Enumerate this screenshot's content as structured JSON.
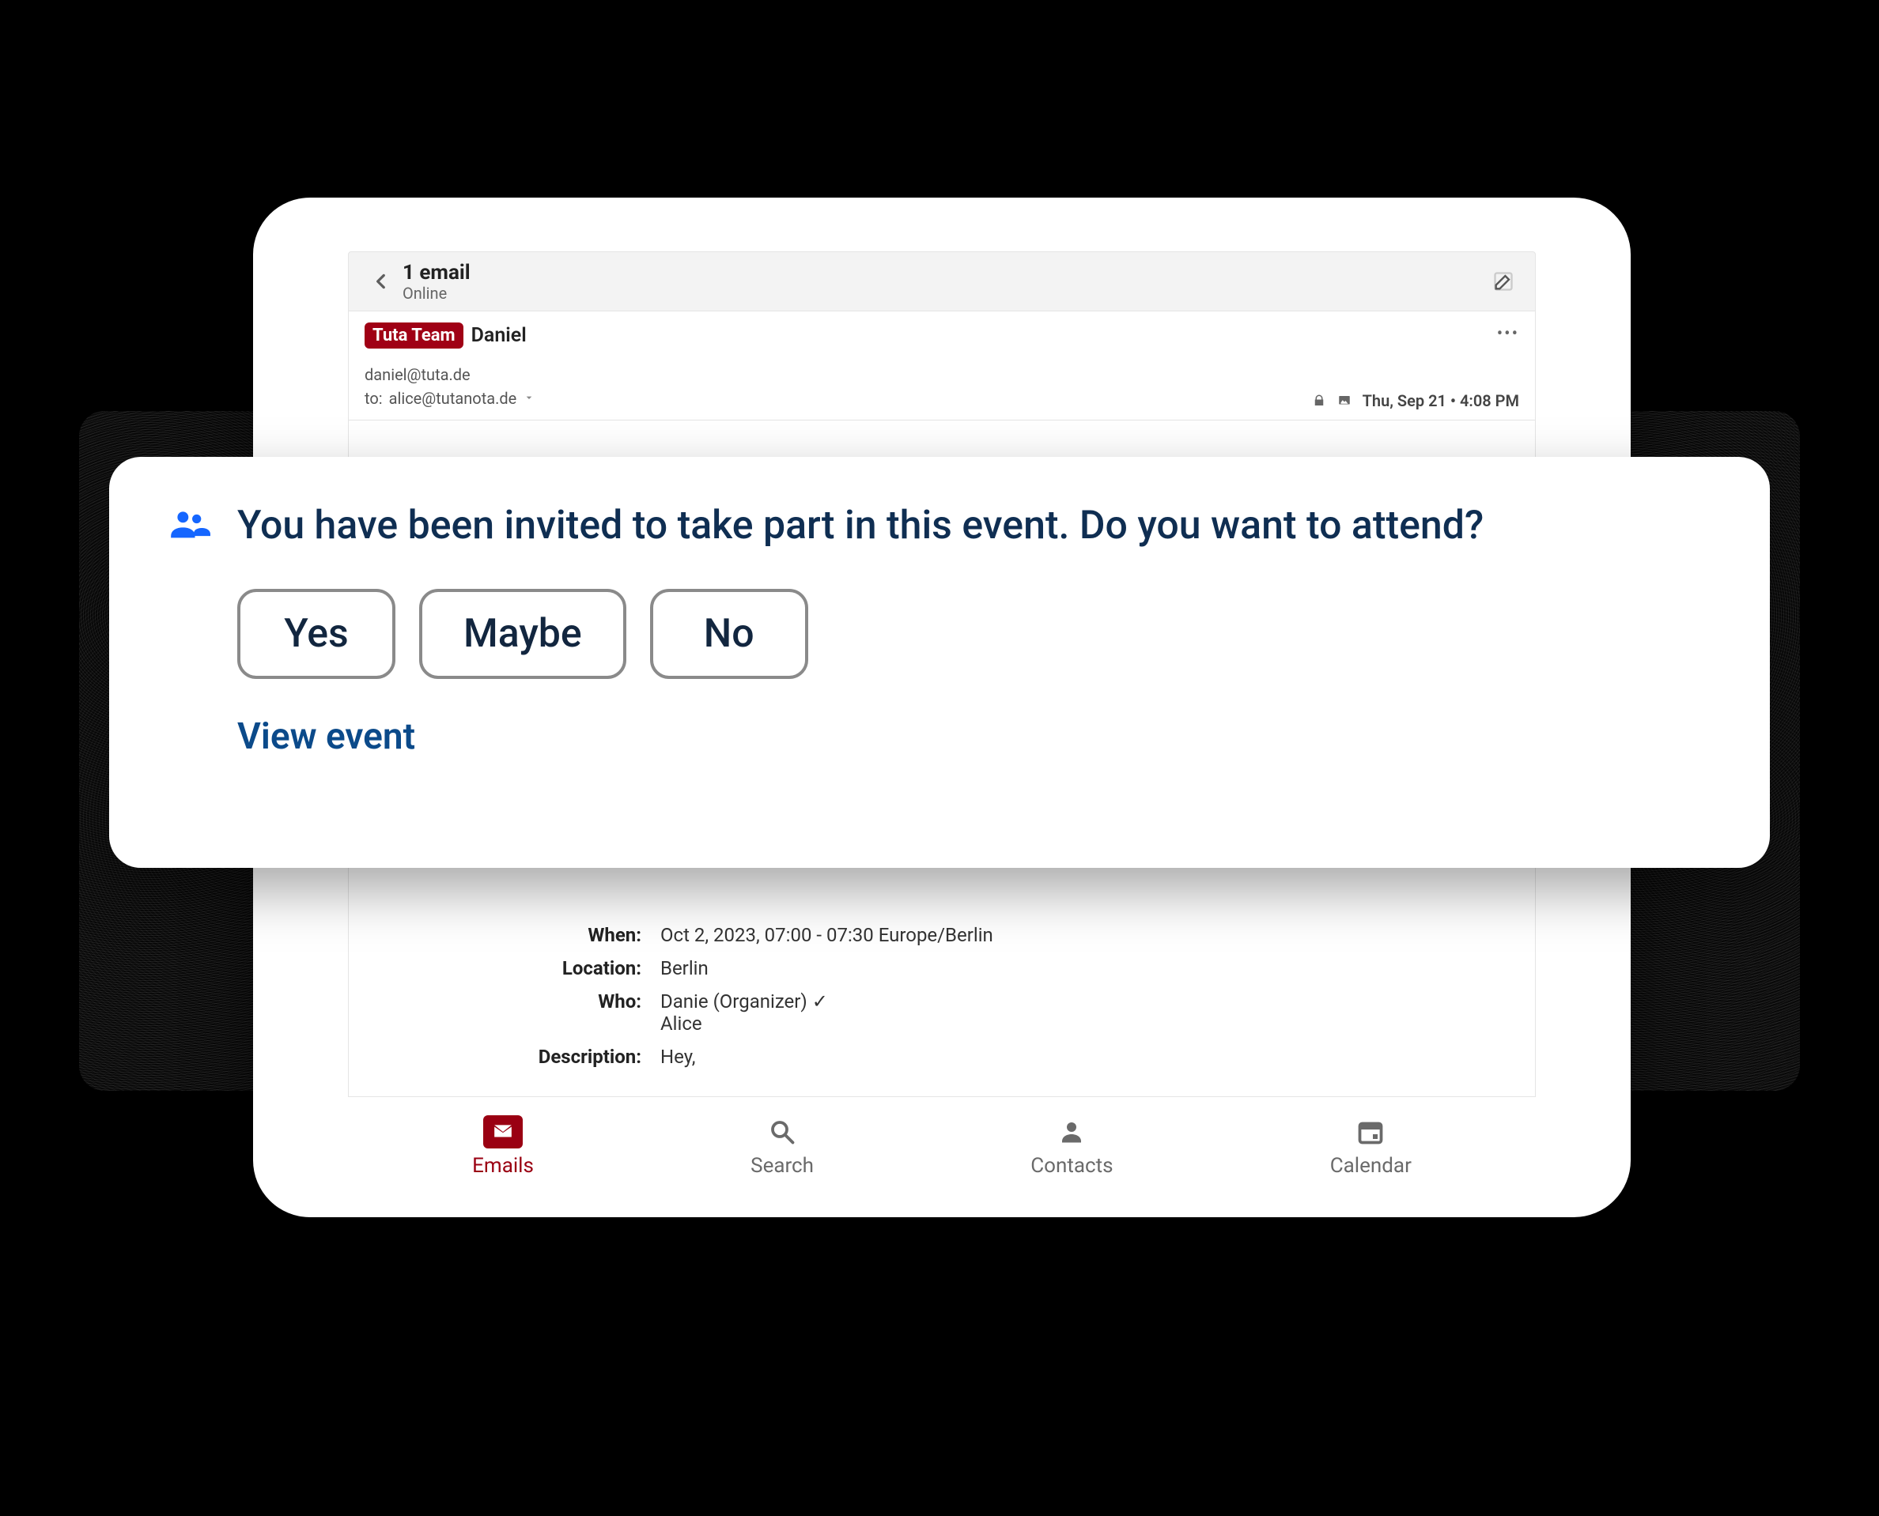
{
  "header": {
    "title": "1 email",
    "subtitle": "Online"
  },
  "mail": {
    "team_badge": "Tuta Team",
    "sender_name": "Daniel",
    "from_address": "daniel@tuta.de",
    "to_prefix": "to:  ",
    "to_address": "alice@tutanota.de",
    "date": "Thu, Sep 21 • 4:08 PM"
  },
  "details": {
    "labels": {
      "when": "When:",
      "location": "Location:",
      "who": "Who:",
      "description": "Description:"
    },
    "when": "Oct 2, 2023, 07:00 - 07:30 Europe/Berlin",
    "location": "Berlin",
    "who_organizer": "Danie (Organizer) ✓",
    "who_attendee": "Alice",
    "description": "Hey,"
  },
  "nav": {
    "emails": "Emails",
    "search": "Search",
    "contacts": "Contacts",
    "calendar": "Calendar"
  },
  "overlay": {
    "prompt": "You have been invited to take part in this event. Do you want to attend?",
    "yes": "Yes",
    "maybe": "Maybe",
    "no": "No",
    "view_event": "View event"
  }
}
